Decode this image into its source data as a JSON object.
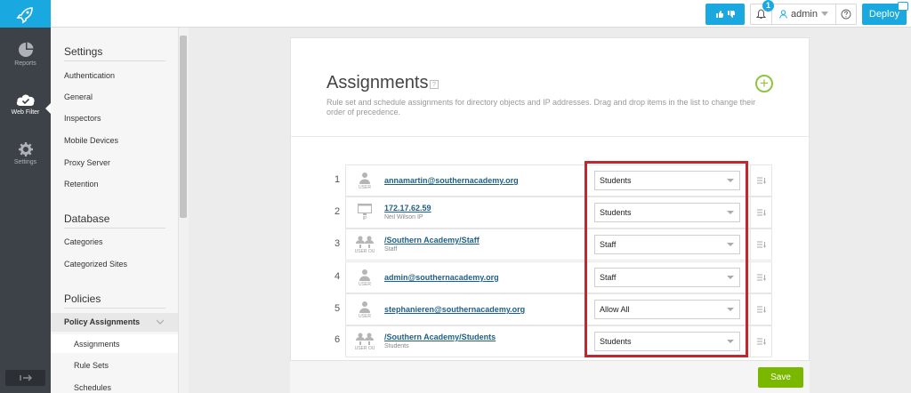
{
  "topbar": {
    "notification_count": "1",
    "user_name": "admin",
    "deploy_label": "Deploy",
    "brand_color": "#19a9e0"
  },
  "leftnav": {
    "items": [
      {
        "label": "Reports",
        "icon": "pie-chart-icon"
      },
      {
        "label": "Web Filter",
        "icon": "cloud-check-icon",
        "active": true
      },
      {
        "label": "Settings",
        "icon": "gear-icon"
      }
    ]
  },
  "menu": {
    "sections": [
      {
        "title": "Settings",
        "items": [
          "Authentication",
          "General",
          "Inspectors",
          "Mobile Devices",
          "Proxy Server",
          "Retention"
        ]
      },
      {
        "title": "Database",
        "items": [
          "Categories",
          "Categorized Sites"
        ]
      },
      {
        "title": "Policies",
        "group": "Policy Assignments",
        "sub_items": [
          "Assignments",
          "Rule Sets",
          "Schedules"
        ]
      }
    ]
  },
  "main": {
    "title": "Assignments",
    "help_glyph": "?",
    "add_glyph": "+",
    "description": "Rule set and schedule assignments for directory objects and IP addresses. Drag and drop items in the list to change their order of precedence.",
    "rows": [
      {
        "num": "1",
        "type": "USER",
        "name": "annamartin@southernacademy.org",
        "sub": "",
        "ruleset": "Students"
      },
      {
        "num": "2",
        "type": "IP",
        "name": "172.17.62.59",
        "sub": "Neil Wilson IP",
        "ruleset": "Students"
      },
      {
        "num": "3",
        "type": "USER OU",
        "name": "/Southern Academy/Staff",
        "sub": "Staff",
        "ruleset": "Staff"
      },
      {
        "num": "4",
        "type": "USER",
        "name": "admin@southernacademy.org",
        "sub": "",
        "ruleset": "Staff"
      },
      {
        "num": "5",
        "type": "USER",
        "name": "stephanieren@southernacademy.org",
        "sub": "",
        "ruleset": "Allow All"
      },
      {
        "num": "6",
        "type": "USER OU",
        "name": "/Southern Academy/Students",
        "sub": "Students",
        "ruleset": "Students"
      }
    ],
    "save_label": "Save",
    "highlight_color": "#c1272d",
    "save_color": "#7ab800"
  }
}
